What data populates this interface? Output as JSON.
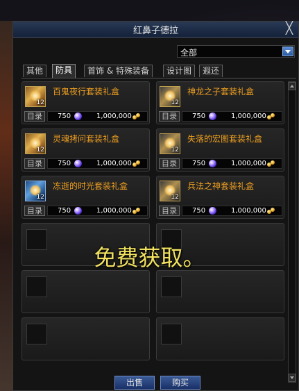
{
  "window": {
    "title": "红鼻子德拉",
    "close_glyph": "╳"
  },
  "filter": {
    "selected": "全部"
  },
  "tabs": [
    {
      "label": "其他",
      "active": false
    },
    {
      "label": "防具",
      "active": true
    },
    {
      "label": "首饰 & 特殊装备",
      "active": false
    },
    {
      "label": "设计图",
      "active": false
    },
    {
      "label": "遐还",
      "active": false
    }
  ],
  "items": [
    {
      "name": "百鬼夜行套装礼盒",
      "icon": "gift-box-icon",
      "count": "12",
      "catalog_label": "目录",
      "cost": "750",
      "gold": "1,000,000"
    },
    {
      "name": "神龙之子套装礼盒",
      "icon": "gift-box-icon",
      "count": "12",
      "catalog_label": "目录",
      "cost": "750",
      "gold": "1,000,000"
    },
    {
      "name": "灵魂拷问套装礼盒",
      "icon": "gift-box-icon",
      "count": "12",
      "catalog_label": "目录",
      "cost": "750",
      "gold": "1,000,000"
    },
    {
      "name": "失落的宏图套装礼盒",
      "icon": "gift-box-icon",
      "count": "12",
      "catalog_label": "目录",
      "cost": "750",
      "gold": "1,000,000"
    },
    {
      "name": "冻逝的时光套装礼盒",
      "icon": "gift-box-icon",
      "count": "12",
      "catalog_label": "目录",
      "cost": "750",
      "gold": "1,000,000"
    },
    {
      "name": "兵法之神套装礼盒",
      "icon": "gift-box-icon",
      "count": "12",
      "catalog_label": "目录",
      "cost": "750",
      "gold": "1,000,000"
    }
  ],
  "overlay": {
    "text": "免费获取。"
  },
  "buttons": {
    "sell": "出售",
    "buy": "购买"
  },
  "colors": {
    "item_name": "#f0a020",
    "overlay_text": "#f2e260",
    "accent": "#3a5a95"
  }
}
